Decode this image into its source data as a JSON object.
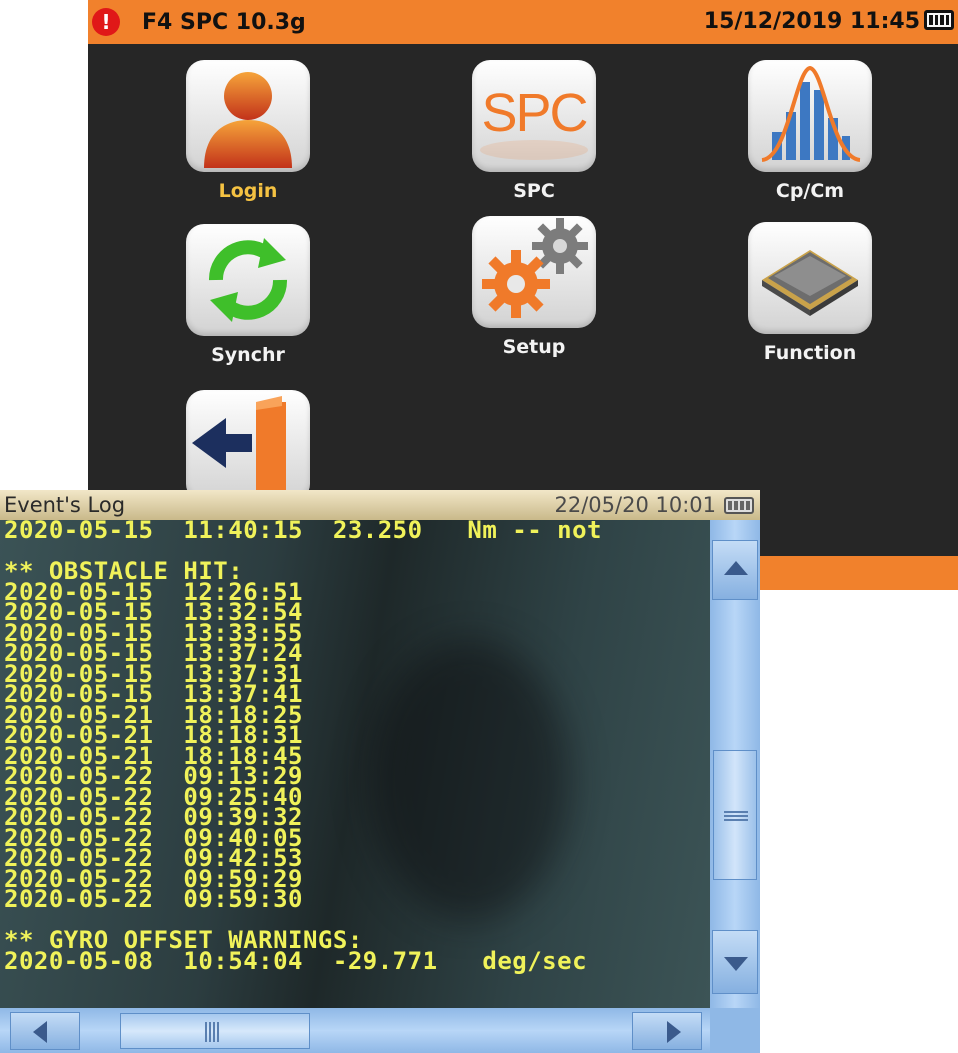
{
  "menu": {
    "title": "F4 SPC 10.3g",
    "datetime": "15/12/2019 11:45",
    "apps": [
      {
        "label": "Login",
        "icon": "user-icon"
      },
      {
        "label": "SPC",
        "icon": "spc-icon",
        "tile_text": "SPC"
      },
      {
        "label": "Cp/Cm",
        "icon": "histogram-icon"
      },
      {
        "label": "Synchr",
        "icon": "sync-icon"
      },
      {
        "label": "Setup",
        "icon": "gears-icon"
      },
      {
        "label": "Function",
        "icon": "chip-icon"
      },
      {
        "label": "",
        "icon": "exit-door-icon"
      }
    ],
    "colors": {
      "accent": "#f1812c",
      "background": "#262626",
      "selected_label": "#f5c242"
    }
  },
  "event_log": {
    "title": "Event's Log",
    "datetime": "22/05/20 10:01",
    "lines": [
      "2020-05-15  11:40:15  23.250   Nm -- not",
      "",
      "** OBSTACLE HIT:",
      "2020-05-15  12:26:51",
      "2020-05-15  13:32:54",
      "2020-05-15  13:33:55",
      "2020-05-15  13:37:24",
      "2020-05-15  13:37:31",
      "2020-05-15  13:37:41",
      "2020-05-21  18:18:25",
      "2020-05-21  18:18:31",
      "2020-05-21  18:18:45",
      "2020-05-22  09:13:29",
      "2020-05-22  09:25:40",
      "2020-05-22  09:39:32",
      "2020-05-22  09:40:05",
      "2020-05-22  09:42:53",
      "2020-05-22  09:59:29",
      "2020-05-22  09:59:30",
      "",
      "** GYRO OFFSET WARNINGS:",
      "2020-05-08  10:54:04  -29.771   deg/sec"
    ],
    "colors": {
      "text": "#f0f25a",
      "scrollbar": "#b8d6f7"
    }
  }
}
